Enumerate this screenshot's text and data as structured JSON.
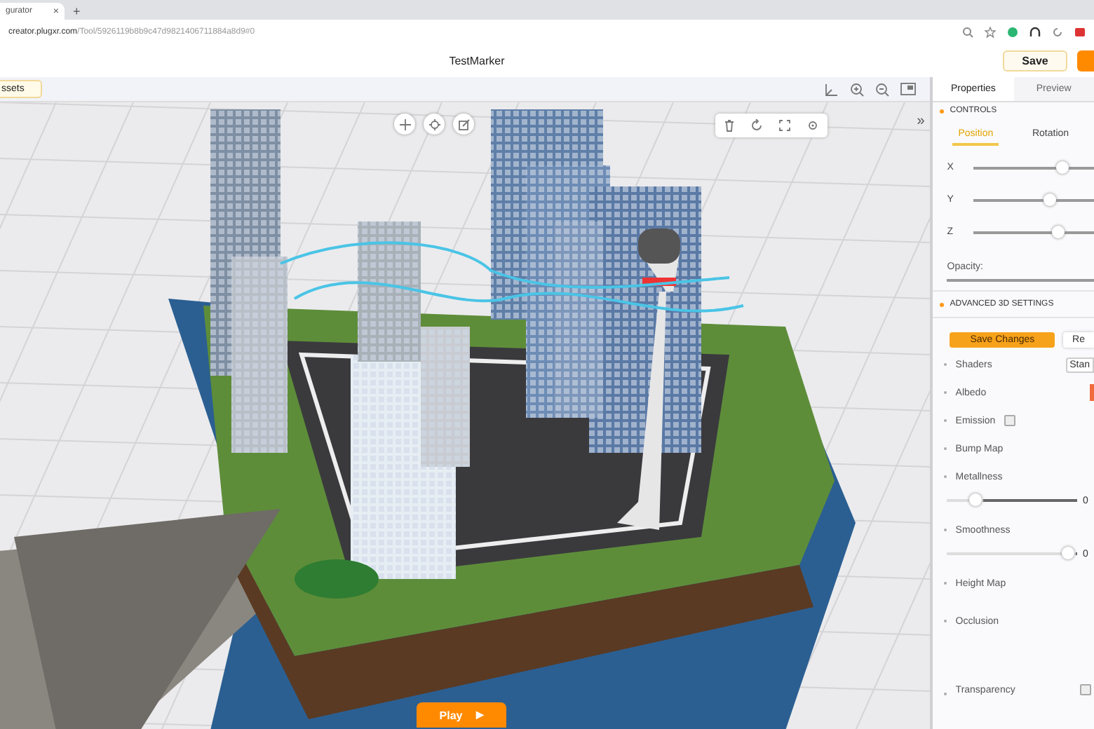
{
  "browser": {
    "tab_title": "gurator",
    "tab_close": "×",
    "new_tab": "+",
    "url_host": "creator.plugxr.com",
    "url_path": "/Tool/5926119b8b9c47d9821406711884a8d9#0"
  },
  "header": {
    "title": "TestMarker",
    "save": "Save"
  },
  "toolbar": {
    "assets": "ssets"
  },
  "viewport": {
    "collapse": "»",
    "play": "Play",
    "play_icon": "▶"
  },
  "panel": {
    "tabs": [
      {
        "label": "Properties",
        "selected": true
      },
      {
        "label": "Preview",
        "selected": false
      }
    ],
    "controls_title": "CONTROLS",
    "transform_tabs": [
      {
        "label": "Position",
        "selected": true
      },
      {
        "label": "Rotation",
        "selected": false
      }
    ],
    "axes": [
      {
        "label": "X",
        "level": 0.6
      },
      {
        "label": "Y",
        "level": 0.52
      },
      {
        "label": "Z",
        "level": 0.58
      }
    ],
    "opacity": {
      "label": "Opacity:",
      "level": 1
    },
    "advanced_title": "ADVANCED 3D SETTINGS",
    "save_changes": "Save Changes",
    "reset": "Re",
    "properties": [
      {
        "kind": "dropdown",
        "label": "Shaders",
        "value": "Stan"
      },
      {
        "kind": "swatch",
        "label": "Albedo"
      },
      {
        "kind": "checkbox",
        "label": "Emission",
        "checked": false
      },
      {
        "kind": "plain",
        "label": "Bump Map"
      },
      {
        "kind": "slider",
        "label": "Metallness",
        "level": 0.22,
        "reading": "0"
      },
      {
        "kind": "slider",
        "label": "Smoothness",
        "level": 0.93,
        "reading": "0"
      },
      {
        "kind": "plain",
        "label": "Height Map"
      },
      {
        "kind": "tall",
        "label": "Occlusion"
      },
      {
        "kind": "checkbox",
        "label": "Transparency",
        "checked": false
      }
    ]
  }
}
